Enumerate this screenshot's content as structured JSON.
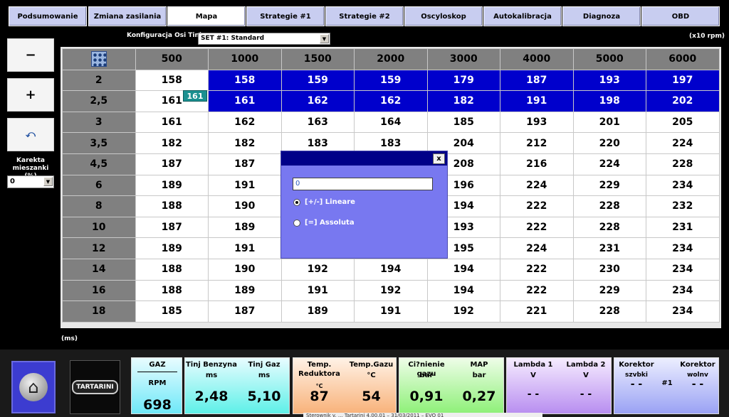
{
  "tabs": [
    {
      "label": "Podsumowanie"
    },
    {
      "label": "Zmiana zasilania"
    },
    {
      "label": "Mapa"
    },
    {
      "label": "Strategie #1"
    },
    {
      "label": "Strategie #2"
    },
    {
      "label": "Oscyloskop"
    },
    {
      "label": "Autokalibracja"
    },
    {
      "label": "Diagnoza"
    },
    {
      "label": "OBD"
    }
  ],
  "active_tab": "Mapa",
  "config": {
    "label": "Konfiguracja Osi Tinj",
    "selected": "SET #1: Standard",
    "rpm_unit": "(x10 rpm)",
    "ms_unit": "(ms)"
  },
  "sidebar": {
    "minus": "−",
    "plus": "+",
    "correction_label": "Karekta mieszanki (%)",
    "correction_value": "0"
  },
  "map": {
    "columns": [
      "500",
      "1000",
      "1500",
      "2000",
      "3000",
      "4000",
      "5000",
      "6000"
    ],
    "rows": [
      {
        "h": "2",
        "v": [
          "158",
          "158",
          "159",
          "159",
          "179",
          "187",
          "193",
          "197"
        ]
      },
      {
        "h": "2,5",
        "v": [
          "161",
          "161",
          "162",
          "162",
          "182",
          "191",
          "198",
          "202"
        ]
      },
      {
        "h": "3",
        "v": [
          "161",
          "162",
          "163",
          "164",
          "185",
          "193",
          "201",
          "205"
        ]
      },
      {
        "h": "3,5",
        "v": [
          "182",
          "182",
          "183",
          "183",
          "204",
          "212",
          "220",
          "224"
        ]
      },
      {
        "h": "4,5",
        "v": [
          "187",
          "187",
          "",
          "",
          "208",
          "216",
          "224",
          "228"
        ]
      },
      {
        "h": "6",
        "v": [
          "189",
          "191",
          "",
          "",
          "196",
          "224",
          "229",
          "234"
        ]
      },
      {
        "h": "8",
        "v": [
          "188",
          "190",
          "",
          "",
          "194",
          "222",
          "228",
          "232"
        ]
      },
      {
        "h": "10",
        "v": [
          "187",
          "189",
          "",
          "",
          "193",
          "222",
          "228",
          "231"
        ]
      },
      {
        "h": "12",
        "v": [
          "189",
          "191",
          "",
          "",
          "195",
          "224",
          "231",
          "234"
        ]
      },
      {
        "h": "14",
        "v": [
          "188",
          "190",
          "192",
          "194",
          "194",
          "222",
          "230",
          "234"
        ]
      },
      {
        "h": "16",
        "v": [
          "188",
          "189",
          "191",
          "192",
          "194",
          "222",
          "229",
          "234"
        ]
      },
      {
        "h": "18",
        "v": [
          "185",
          "187",
          "189",
          "191",
          "192",
          "221",
          "228",
          "234"
        ]
      }
    ],
    "hint": "161"
  },
  "dialog": {
    "close": "x",
    "input_value": "0",
    "option_linear": "[+/-] Lineare",
    "option_absolute": "[=] Assoluta"
  },
  "panels": {
    "gaz": {
      "title": "GAZ",
      "rpm_label": "RPM",
      "rpm": "698"
    },
    "tinj": {
      "benz_label": "Tinj Benzyna",
      "benz_unit": "ms",
      "benz": "2,48",
      "gaz_label": "Tinj Gaz",
      "gaz_unit": "ms",
      "gaz": "5,10"
    },
    "temp": {
      "red_label": "Temp. Reduktora",
      "red_unit": "°C",
      "red": "87",
      "gas_label": "Temp.Gazu",
      "gas_unit": "°C",
      "gas": "54"
    },
    "press": {
      "p_label": "Ci?nienie gazu",
      "p_unit": "bar",
      "p": "0,91",
      "map_label": "MAP",
      "map_unit": "bar",
      "map": "0,27"
    },
    "lambda": {
      "l1_label": "Lambda 1",
      "l1_unit": "V",
      "l1": "- -",
      "l2_label": "Lambda 2",
      "l2_unit": "V",
      "l2": "- -"
    },
    "korektor": {
      "k1_label": "Korektor",
      "k1_sub": "szybki",
      "k1": "- -",
      "num": "#1",
      "k2_label": "Korektor",
      "k2_sub": "wolny",
      "k2": "- -"
    }
  },
  "status": "Sterownik v. ... Tartarini 4.00.01 – 31/03/2011 – EVO 01"
}
